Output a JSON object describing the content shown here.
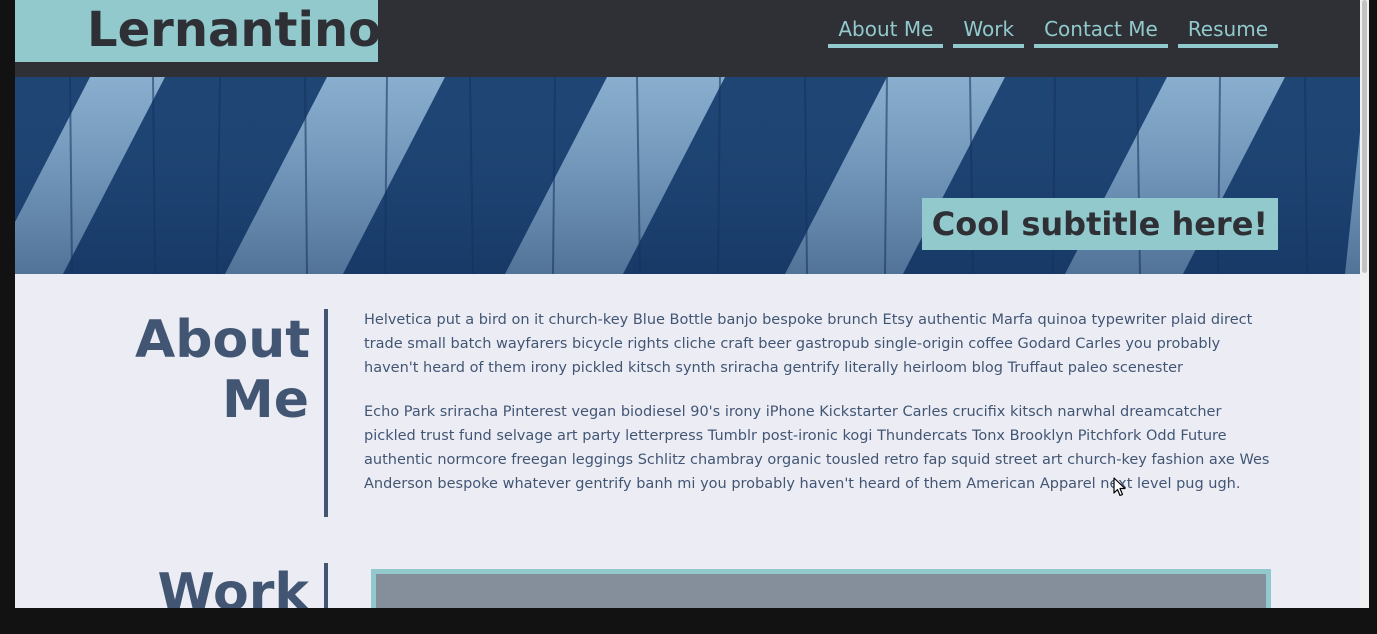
{
  "header": {
    "logo": "Lernantino",
    "nav": [
      {
        "label": "About Me"
      },
      {
        "label": "Work"
      },
      {
        "label": "Contact Me"
      },
      {
        "label": "Resume"
      }
    ]
  },
  "hero": {
    "subtitle": "Cool subtitle here!"
  },
  "about": {
    "title_line1": "About",
    "title_line2": "Me",
    "paragraphs": [
      "Helvetica put a bird on it church-key Blue Bottle banjo bespoke brunch Etsy authentic Marfa quinoa typewriter plaid direct trade small batch wayfarers bicycle rights cliche craft beer gastropub single-origin coffee Godard Carles you probably haven't heard of them irony pickled kitsch synth sriracha gentrify literally heirloom blog Truffaut paleo scenester",
      "Echo Park sriracha Pinterest vegan biodiesel 90's irony iPhone Kickstarter Carles crucifix kitsch narwhal dreamcatcher pickled trust fund selvage art party letterpress Tumblr post-ironic kogi Thundercats Tonx Brooklyn Pitchfork Odd Future authentic normcore freegan leggings Schlitz chambray organic tousled retro fap squid street art church-key fashion axe Wes Anderson bespoke whatever gentrify banh mi you probably haven't heard of them American Apparel next level pug ugh."
    ]
  },
  "work": {
    "title": "Work"
  },
  "colors": {
    "accent": "#91c9cc",
    "dark": "#2e3035",
    "text": "#425674",
    "background": "#ecedf4"
  },
  "icons": {
    "cursor": "mouse-pointer-icon"
  }
}
